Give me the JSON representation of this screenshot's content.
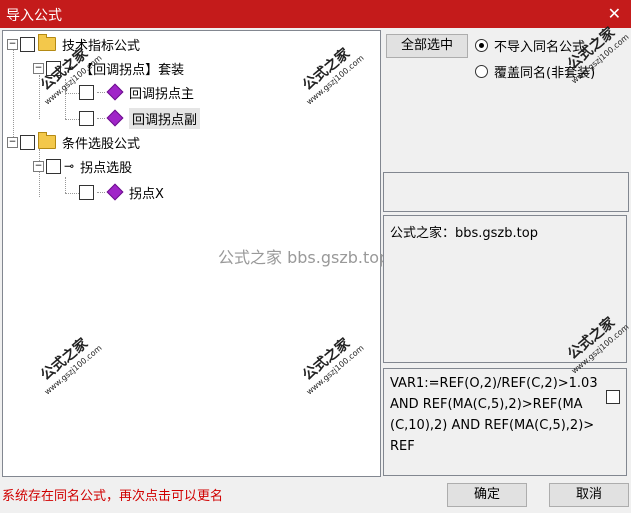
{
  "window": {
    "title": "导入公式",
    "close_glyph": "✕"
  },
  "tree": {
    "items": [
      {
        "label": "技术指标公式"
      },
      {
        "label": "【回调拐点】套装"
      },
      {
        "label": "回调拐点主"
      },
      {
        "label": "回调拐点副"
      },
      {
        "label": "条件选股公式"
      },
      {
        "label": "拐点选股"
      },
      {
        "label": "拐点X"
      }
    ],
    "expand_glyph": "−"
  },
  "watermarks": {
    "small_title": "公式之家",
    "small_url": "www.gszj100.com",
    "center": "公式之家 bbs.gszb.top"
  },
  "right": {
    "select_all_label": "全部选中",
    "radio_no_import": "不导入同名公式",
    "radio_overwrite": "覆盖同名(非套装)",
    "description": "公式之家：bbs.gszb.top",
    "formula": "VAR1:=REF(O,2)/REF(C,2)>1.03 AND REF(MA(C,5),2)>REF(MA(C,10),2) AND REF(MA(C,5),2)>REF"
  },
  "footer": {
    "status": "系统存在同名公式，再次点击可以更名",
    "ok_label": "确定",
    "cancel_label": "取消"
  },
  "colors": {
    "title_bar": "#c41b1b",
    "status_text": "#d00000",
    "gem": "#a024c8"
  },
  "icons": [
    "folder-icon",
    "gem-icon",
    "key-icon",
    "close-icon"
  ]
}
